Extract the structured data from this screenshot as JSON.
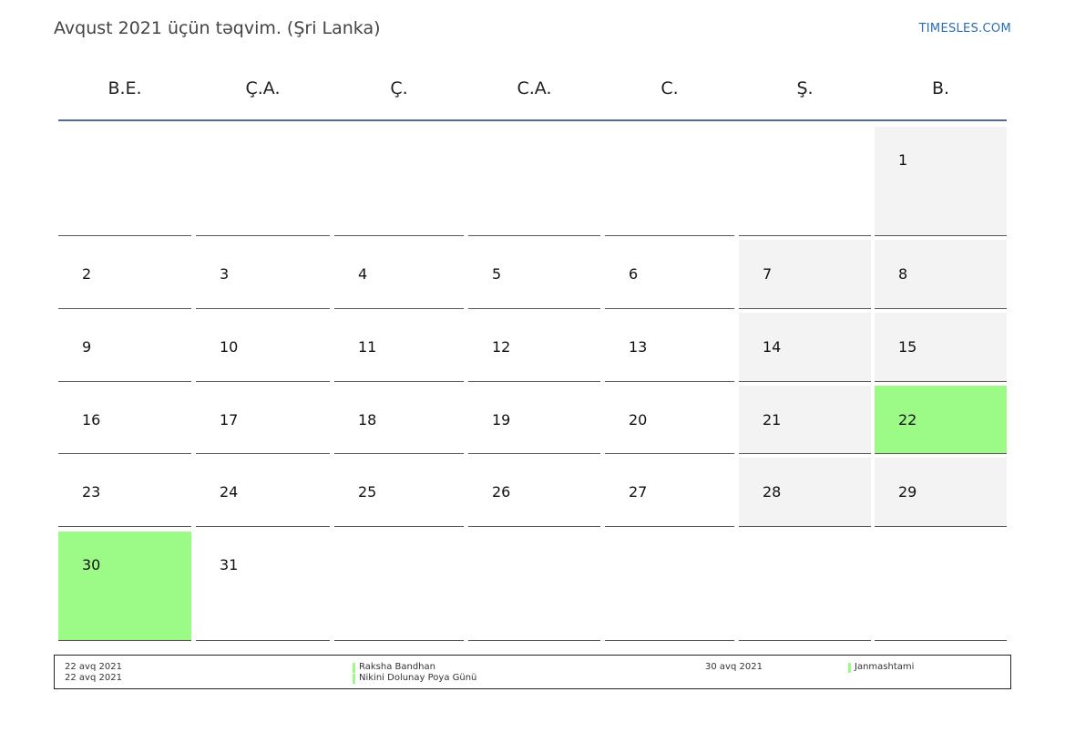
{
  "header": {
    "title": "Avqust 2021 üçün təqvim. (Şri Lanka)",
    "brand": "TIMESLES.COM"
  },
  "weekdays": [
    "B.E.",
    "Ç.A.",
    "Ç.",
    "C.A.",
    "C.",
    "Ş.",
    "B."
  ],
  "calendar": {
    "weeks": [
      [
        null,
        null,
        null,
        null,
        null,
        null,
        1
      ],
      [
        2,
        3,
        4,
        5,
        6,
        7,
        8
      ],
      [
        9,
        10,
        11,
        12,
        13,
        14,
        15
      ],
      [
        16,
        17,
        18,
        19,
        20,
        21,
        22
      ],
      [
        23,
        24,
        25,
        26,
        27,
        28,
        29
      ],
      [
        30,
        31,
        null,
        null,
        null,
        null,
        null
      ]
    ],
    "holiday_days": [
      22,
      30
    ]
  },
  "legend": [
    {
      "date": "22 avq 2021",
      "name": "Raksha Bandhan"
    },
    {
      "date": "22 avq 2021",
      "name": "Nikini Dolunay Poya Günü"
    },
    {
      "date": "30 avq 2021",
      "name": "Janmashtami"
    }
  ],
  "colors": {
    "holiday": "#9cfb86",
    "weekend": "#f3f3f3",
    "header_rule": "#4f6b8f",
    "brand": "#2a6db5"
  }
}
